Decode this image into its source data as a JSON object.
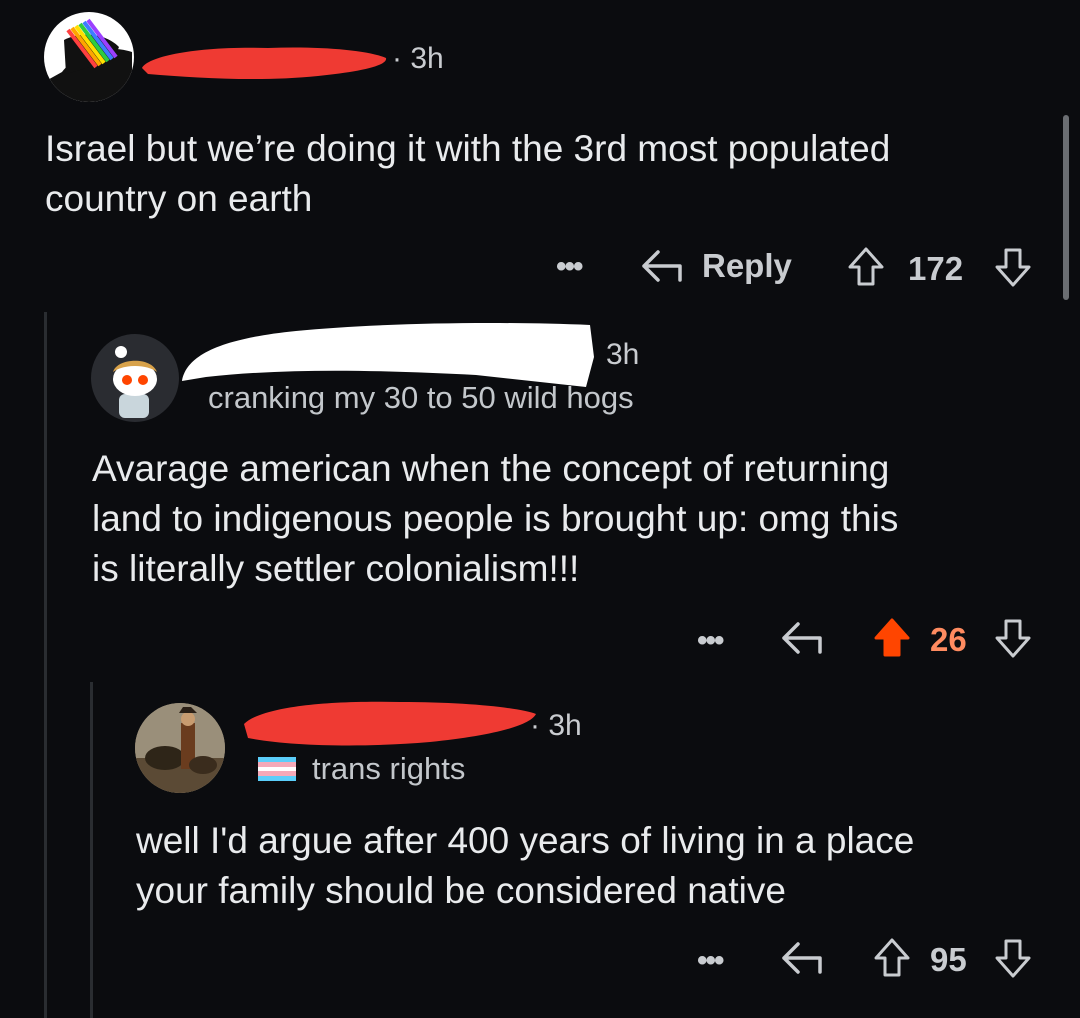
{
  "comments": [
    {
      "time": "3h",
      "body_lines": [
        "Israel but we’re doing it with the 3rd most populated",
        "country on earth"
      ],
      "reply_label": "Reply",
      "score": "172"
    },
    {
      "time": "3h",
      "flair": "cranking my 30 to 50 wild hogs",
      "body_lines": [
        "Avarage american when the concept of returning",
        "land to indigenous people is brought up: omg this",
        "is literally settler colonialism!!!"
      ],
      "score": "26"
    },
    {
      "time": "3h",
      "flair": "trans rights",
      "body_lines": [
        "well I'd argue after 400 years of living in a place",
        "your family should be considered native"
      ],
      "score": "95"
    }
  ],
  "colors": {
    "upvoted": "#ff4500",
    "score_upvoted": "#ff8b60",
    "redaction_red": "#ef3a33"
  },
  "icons": [
    "more-icon",
    "reply-icon",
    "upvote-icon",
    "downvote-icon"
  ]
}
